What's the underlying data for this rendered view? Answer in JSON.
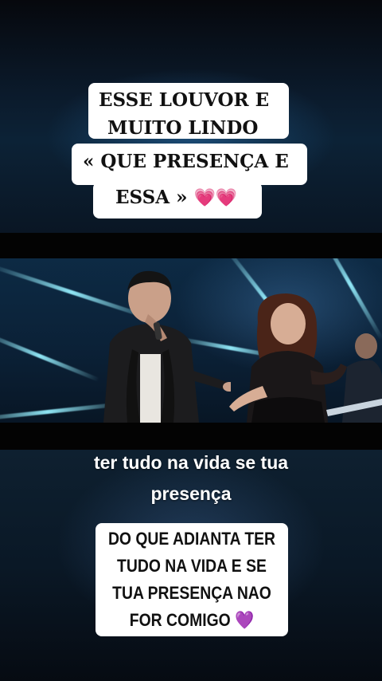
{
  "top_caption": {
    "lines": [
      "ESSE LOUVOR E",
      "MUITO LINDO",
      "« QUE PRESENÇA E",
      "ESSA »"
    ],
    "emoji": "💗💗"
  },
  "subtitle": {
    "lines": [
      "ter tudo na vida se tua",
      "presença"
    ]
  },
  "bottom_caption": {
    "lines": [
      "DO QUE ADIANTA TER",
      "TUDO NA VIDA E SE",
      "TUA PRESENÇA NAO",
      "FOR COMIGO"
    ],
    "emoji": "💜"
  },
  "colors": {
    "caption_bg": "#ffffff",
    "caption_text": "#111111",
    "subtitle_text": "#ffffff",
    "stage_light": "#8ee8ff"
  }
}
